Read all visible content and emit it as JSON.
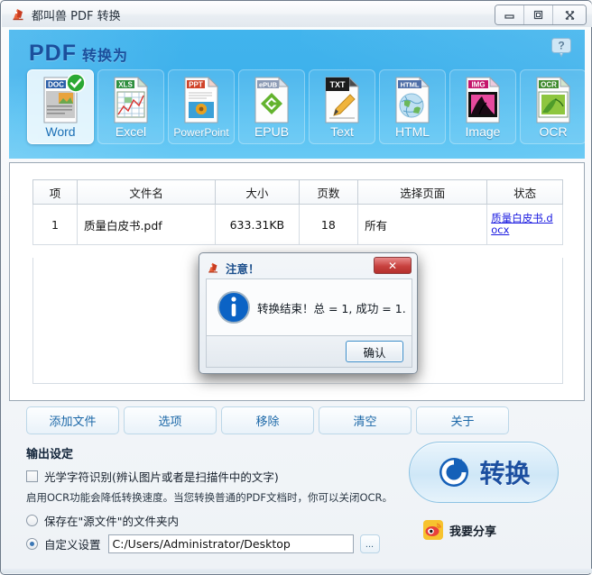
{
  "window": {
    "title": "都叫兽 PDF 转换",
    "app_icon": "app-logo-icon",
    "minimize_label": "—",
    "maximize_label": "□",
    "close_label": "✕"
  },
  "header": {
    "title_main": "PDF",
    "title_sub": "转换为",
    "help_label": "?",
    "accent_color": "#41b4ed",
    "title_color": "#1b4f9c"
  },
  "formats": [
    {
      "label": "Word",
      "badge": "DOC",
      "selected": true,
      "icon": "doc-file-icon",
      "header_color": "#2c5fa8"
    },
    {
      "label": "Excel",
      "badge": "XLS",
      "selected": false,
      "icon": "xls-file-icon",
      "header_color": "#2f8f3f"
    },
    {
      "label": "PowerPoint",
      "badge": "PPT",
      "selected": false,
      "icon": "ppt-file-icon",
      "header_color": "#d0442a"
    },
    {
      "label": "EPUB",
      "badge": "ePUB",
      "selected": false,
      "icon": "epub-file-icon",
      "header_color": "#8c9bb5"
    },
    {
      "label": "Text",
      "badge": "TXT",
      "selected": false,
      "icon": "txt-file-icon",
      "header_color": "#1c1c1c"
    },
    {
      "label": "HTML",
      "badge": "HTML",
      "selected": false,
      "icon": "html-file-icon",
      "header_color": "#4f6fa8"
    },
    {
      "label": "Image",
      "badge": "IMG",
      "selected": false,
      "icon": "image-file-icon",
      "header_color": "#c4156b"
    },
    {
      "label": "OCR",
      "badge": "OCR",
      "selected": false,
      "icon": "ocr-file-icon",
      "header_color": "#3f8b2e"
    }
  ],
  "filelist": {
    "columns": [
      "项",
      "文件名",
      "大小",
      "页数",
      "选择页面",
      "状态"
    ],
    "rows": [
      {
        "index": "1",
        "filename": "质量白皮书.pdf",
        "size": "633.31KB",
        "pages": "18",
        "page_range": "所有",
        "status_link": "质量白皮书.docx"
      }
    ]
  },
  "actions": [
    {
      "label": "添加文件",
      "name": "add-file-button"
    },
    {
      "label": "选项",
      "name": "options-button"
    },
    {
      "label": "移除",
      "name": "remove-button"
    },
    {
      "label": "清空",
      "name": "clear-button"
    },
    {
      "label": "关于",
      "name": "about-button"
    }
  ],
  "output": {
    "title": "输出设定",
    "ocr_checkbox_label": "光学字符识别(辨认图片或者是扫描件中的文字)",
    "ocr_checked": false,
    "ocr_hint": "启用OCR功能会降低转换速度。当您转换普通的PDF文档时，你可以关闭OCR。",
    "radio_source_label": "保存在\"源文件\"的文件夹内",
    "radio_custom_label": "自定义设置",
    "selected_radio": "custom",
    "path_value": "C:/Users/Administrator/Desktop",
    "browse_label": "..."
  },
  "convert": {
    "label": "转换",
    "icon": "refresh-circle-icon",
    "share_label": "我要分享",
    "share_icon": "weibo-icon"
  },
  "dialog": {
    "title": "注意！",
    "icon": "app-logo-icon",
    "info_icon": "info-icon",
    "message": "转换结束！总 = 1, 成功 = 1.",
    "ok_label": "确认",
    "close_label": "✕"
  }
}
